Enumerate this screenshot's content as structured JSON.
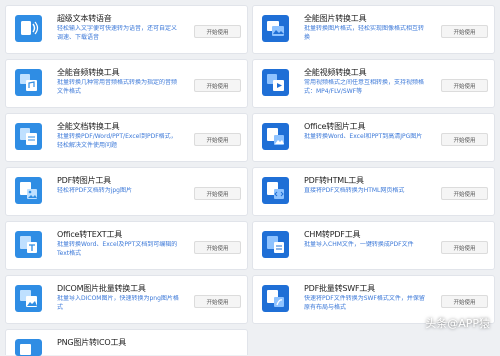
{
  "tools": [
    {
      "title": "超级文本转语音",
      "desc": "轻松输入文字便可快速转为语音，还可自定义调速、下载语音",
      "button": "开始使用",
      "icon": "text-to-speech-icon"
    },
    {
      "title": "全能图片转换工具",
      "desc": "批量转换图片格式，轻松实现图像格式相互转换",
      "button": "开始使用",
      "icon": "image-convert-icon"
    },
    {
      "title": "全能音频转换工具",
      "desc": "批量转换几种常用音频格式转换为指定的音频文件格式",
      "button": "开始使用",
      "icon": "audio-convert-icon"
    },
    {
      "title": "全能视频转换工具",
      "desc": "常用视频格式之间任意互相转换，支持视频格式：MP4/FLV/SWF等",
      "button": "开始使用",
      "icon": "video-convert-icon"
    },
    {
      "title": "全能文档转换工具",
      "desc": "批量转换PDF/Word/PPT/Excel到PDF格式，轻松解决文件使用问题",
      "button": "开始使用",
      "icon": "document-convert-icon"
    },
    {
      "title": "Office转图片工具",
      "desc": "批量转换Word、Excel和PPT到高清JPG图片",
      "button": "开始使用",
      "icon": "office-to-image-icon"
    },
    {
      "title": "PDF转图片工具",
      "desc": "轻松将PDF文档转为jpg图片",
      "button": "开始使用",
      "icon": "pdf-to-image-icon"
    },
    {
      "title": "PDF转HTML工具",
      "desc": "直接将PDF文档转换为HTML网页格式",
      "button": "开始使用",
      "icon": "pdf-to-html-icon"
    },
    {
      "title": "Office转TEXT工具",
      "desc": "批量转换Word、Excel及PPT文档到可编辑的Text格式",
      "button": "开始使用",
      "icon": "office-to-text-icon"
    },
    {
      "title": "CHM转PDF工具",
      "desc": "批量导入CHM文件，一键转换成PDF文件",
      "button": "开始使用",
      "icon": "chm-to-pdf-icon"
    },
    {
      "title": "DICOM图片批量转换工具",
      "desc": "批量导入DICOM图片，快速转换为png图片格式",
      "button": "开始使用",
      "icon": "dicom-convert-icon"
    },
    {
      "title": "PDF批量转SWF工具",
      "desc": "快速将PDF文件转换为SWF格式文件，并保留原有布局与格式",
      "button": "开始使用",
      "icon": "pdf-to-swf-icon"
    },
    {
      "title": "PNG图片转ICO工具",
      "desc": "",
      "button": "",
      "icon": "png-to-ico-icon"
    }
  ],
  "watermark": "头条@APP猿",
  "colors": {
    "accent_dark": "#1a73d9",
    "accent_light": "#3fa0f0",
    "link_text": "#3b78d8"
  }
}
